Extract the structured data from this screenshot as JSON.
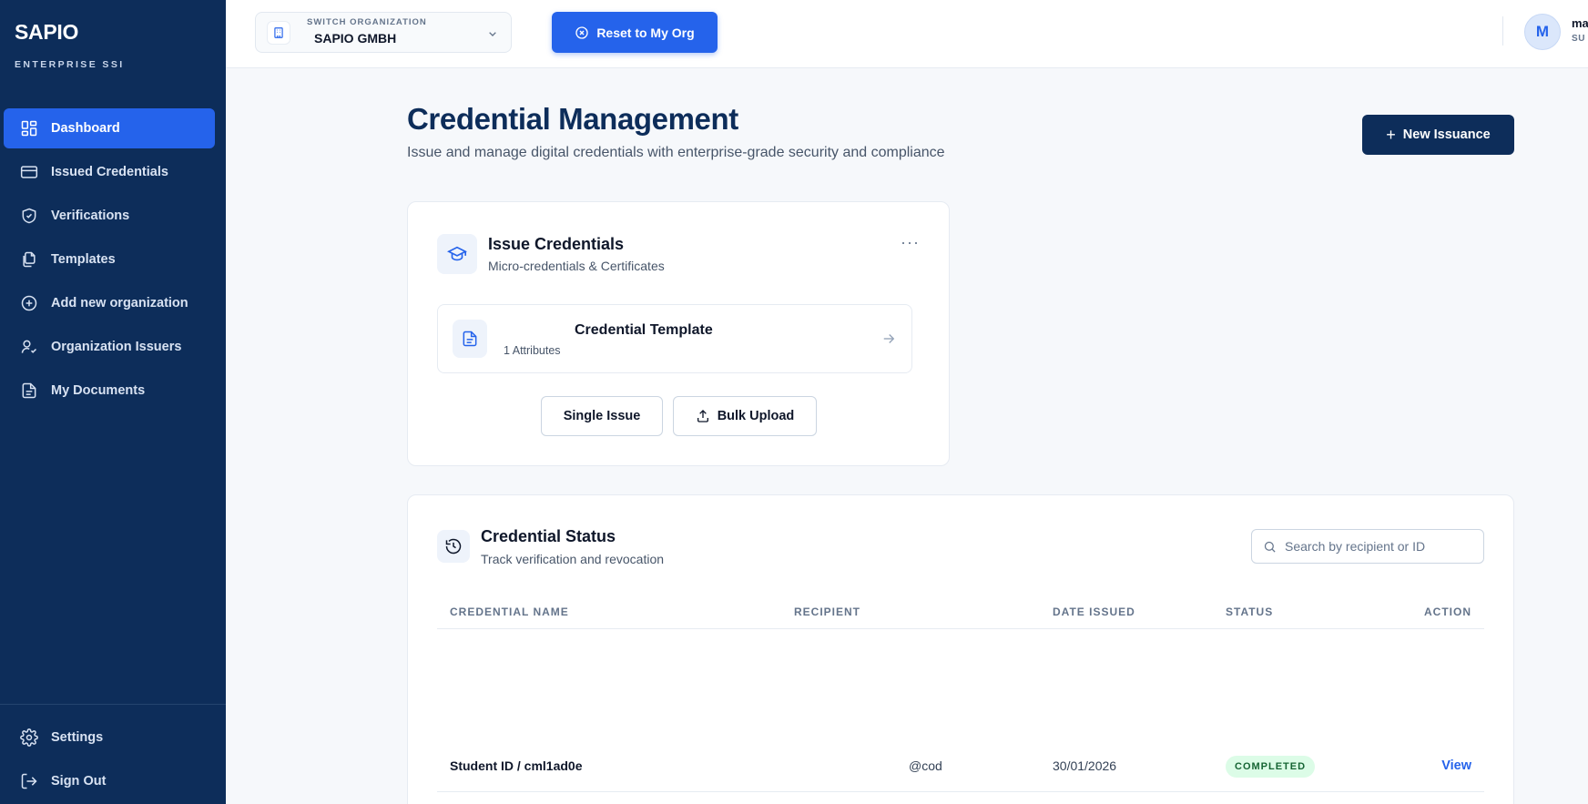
{
  "brand": {
    "name": "SAPIO",
    "tagline": "ENTERPRISE SSI"
  },
  "sidebar": {
    "items": [
      {
        "label": "Dashboard",
        "icon": "dashboard-icon",
        "active": true
      },
      {
        "label": "Issued Credentials",
        "icon": "credit-card-icon"
      },
      {
        "label": "Verifications",
        "icon": "shield-check-icon"
      },
      {
        "label": "Templates",
        "icon": "files-icon"
      },
      {
        "label": "Add new organization",
        "icon": "plus-circle-icon"
      },
      {
        "label": "Organization Issuers",
        "icon": "user-check-icon"
      },
      {
        "label": "My Documents",
        "icon": "document-icon"
      }
    ],
    "bottom": [
      {
        "label": "Settings",
        "icon": "gear-icon"
      },
      {
        "label": "Sign Out",
        "icon": "sign-out-icon"
      }
    ]
  },
  "topbar": {
    "org_label": "SWITCH ORGANIZATION",
    "org_name": "SAPIO GMBH",
    "reset_label": "Reset to My Org",
    "avatar_initial": "M",
    "user_name": "ma",
    "user_role": "SU"
  },
  "header": {
    "title": "Credential Management",
    "subtitle": "Issue and manage digital credentials with enterprise-grade security and compliance",
    "new_issuance_label": "New Issuance"
  },
  "issue_card": {
    "title": "Issue Credentials",
    "subtitle": "Micro-credentials & Certificates",
    "more": "···",
    "template": {
      "title": "Credential Template",
      "attributes": "1 Attributes"
    },
    "single_label": "Single Issue",
    "bulk_label": "Bulk Upload"
  },
  "status_card": {
    "title": "Credential Status",
    "subtitle": "Track verification and revocation",
    "search_placeholder": "Search by recipient or ID",
    "columns": [
      "CREDENTIAL NAME",
      "RECIPIENT",
      "DATE ISSUED",
      "STATUS",
      "ACTION"
    ],
    "rows": [
      {
        "name": "Student ID / cml1ad0e",
        "recipient": "@cod",
        "date": "30/01/2026",
        "status": "COMPLETED",
        "action": "View"
      }
    ]
  },
  "colors": {
    "sidebar_bg": "#0d2d5a",
    "accent": "#2563eb",
    "status_completed_bg": "#dcfce7",
    "status_completed_text": "#166534"
  }
}
